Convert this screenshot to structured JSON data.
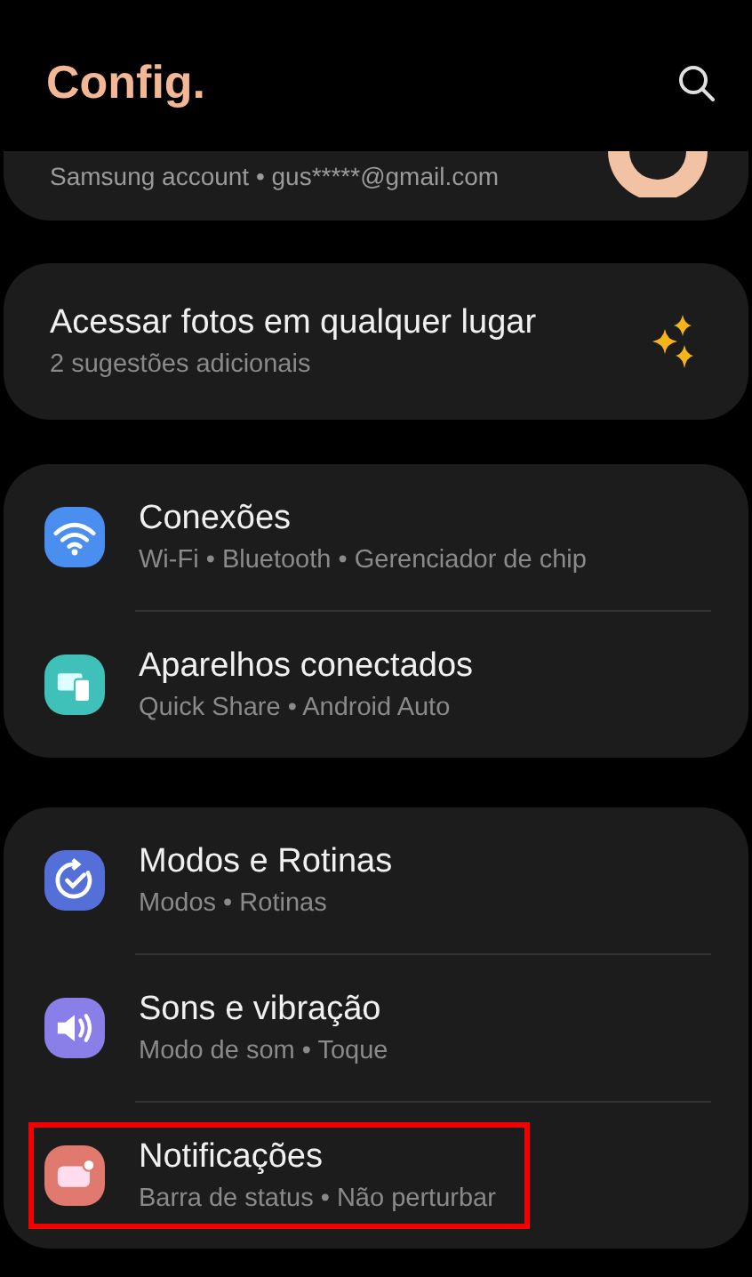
{
  "header": {
    "title": "Config."
  },
  "account": {
    "subtitle": "Samsung account • gus*****@gmail.com"
  },
  "suggestion": {
    "title": "Acessar fotos em qualquer lugar",
    "subtitle": "2 sugestões adicionais"
  },
  "groups": [
    {
      "items": [
        {
          "kind": "wifi",
          "color": "#4a8ff0",
          "title": "Conexões",
          "subtitle": "Wi-Fi • Bluetooth • Gerenciador de chip",
          "highlighted": false
        },
        {
          "kind": "devices",
          "color": "#3fc0b8",
          "title": "Aparelhos conectados",
          "subtitle": "Quick Share • Android Auto",
          "highlighted": false
        }
      ]
    },
    {
      "items": [
        {
          "kind": "modes",
          "color": "#5470d8",
          "title": "Modos e Rotinas",
          "subtitle": "Modos • Rotinas",
          "highlighted": false
        },
        {
          "kind": "sound",
          "color": "#8a7ee8",
          "title": "Sons e vibração",
          "subtitle": "Modo de som • Toque",
          "highlighted": false
        },
        {
          "kind": "notifications",
          "color": "#e07a6e",
          "title": "Notificações",
          "subtitle": "Barra de status • Não perturbar",
          "highlighted": true
        }
      ]
    }
  ]
}
